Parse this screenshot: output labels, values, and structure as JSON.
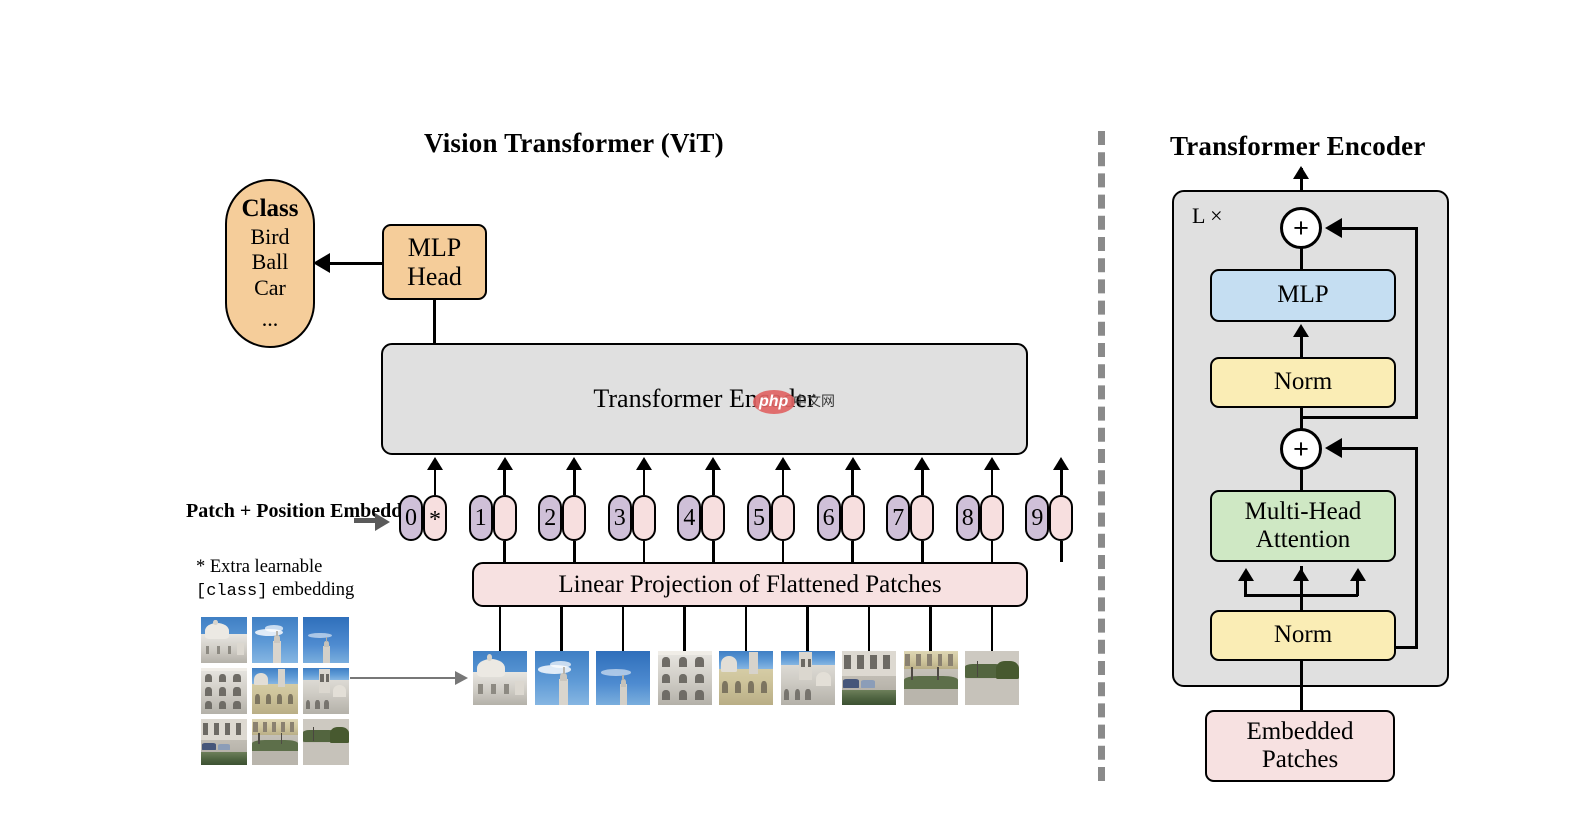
{
  "figure": {
    "left_title": "Vision Transformer (ViT)",
    "right_title": "Transformer Encoder"
  },
  "class_panel": {
    "heading": "Class",
    "items": [
      "Bird",
      "Ball",
      "Car"
    ],
    "ellipsis": "..."
  },
  "left_column": {
    "mlp_head": "MLP\nHead",
    "mlp_head_line1": "MLP",
    "mlp_head_line2": "Head",
    "encoder_bar": "Transformer Encoder",
    "linear_projection": "Linear Projection of Flattened Patches"
  },
  "annotations": {
    "patch_position_line1": "Patch + Position",
    "patch_position_line2": "Embedding",
    "note_line1": "* Extra learnable",
    "note_mono": "[class]",
    "note_line2_tail": " embedding"
  },
  "tokens": [
    {
      "num": "0",
      "mark": "*"
    },
    {
      "num": "1",
      "mark": ""
    },
    {
      "num": "2",
      "mark": ""
    },
    {
      "num": "3",
      "mark": ""
    },
    {
      "num": "4",
      "mark": ""
    },
    {
      "num": "5",
      "mark": ""
    },
    {
      "num": "6",
      "mark": ""
    },
    {
      "num": "7",
      "mark": ""
    },
    {
      "num": "8",
      "mark": ""
    },
    {
      "num": "9",
      "mark": ""
    }
  ],
  "encoder": {
    "repeat_label": "L ×",
    "mlp": "MLP",
    "norm_top": "Norm",
    "attention_line1": "Multi-Head",
    "attention_line2": "Attention",
    "norm_bottom": "Norm",
    "embedded_patches_line1": "Embedded",
    "embedded_patches_line2": "Patches",
    "plus_symbol": "+"
  },
  "watermark": {
    "brand": "php",
    "suffix": "中文网"
  },
  "colors": {
    "orange": "#f5cd9a",
    "pink": "#f7e1e1",
    "gray_panel": "#e0e0e0",
    "token_purple": "#cfc0d8",
    "token_pink": "#f7dfdf",
    "mlp_blue": "#c5def2",
    "norm_yellow": "#faedb5",
    "attention_green": "#cfe8c4",
    "divider_gray": "#8a8a8a",
    "stroke": "#000000"
  }
}
